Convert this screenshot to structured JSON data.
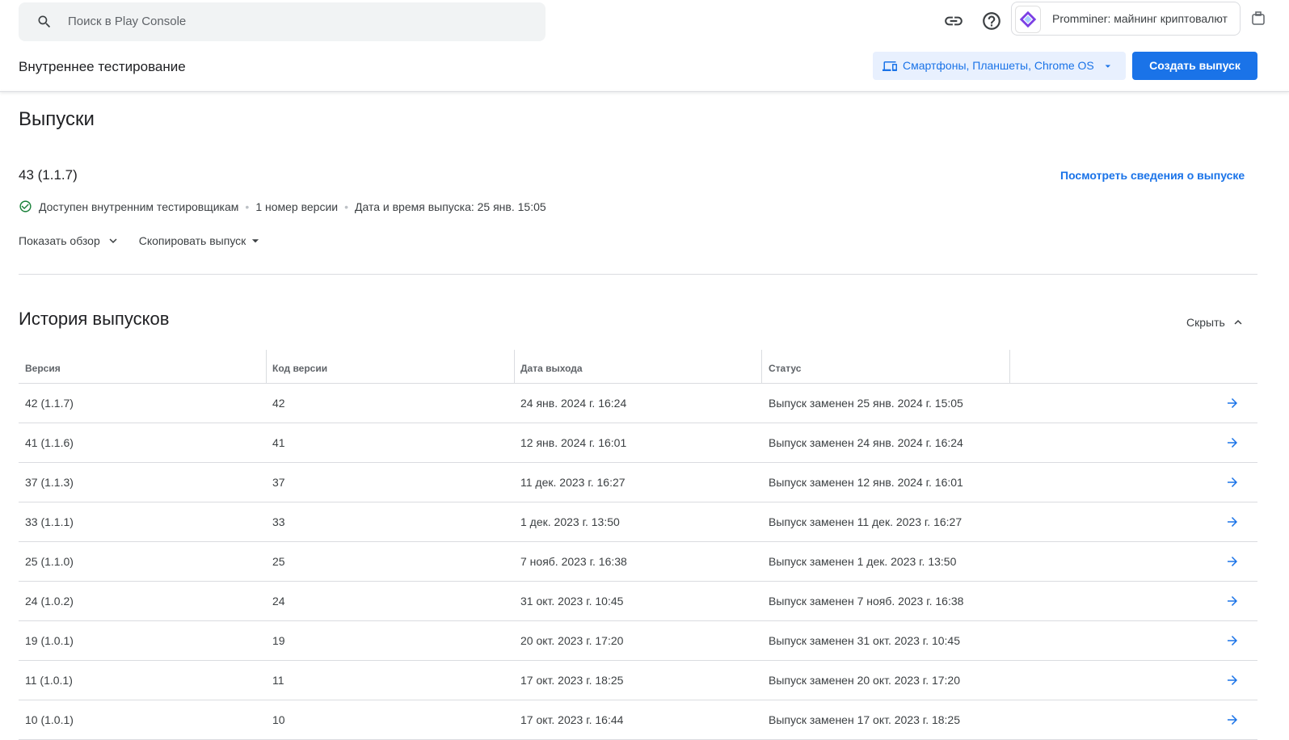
{
  "search": {
    "placeholder": "Поиск в Play Console"
  },
  "app": {
    "name": "Promminer: майнинг криптовалют"
  },
  "header": {
    "title": "Внутреннее тестирование",
    "device_label": "Смартфоны, Планшеты, Chrome OS",
    "create_label": "Создать выпуск"
  },
  "releases": {
    "title": "Выпуски",
    "current": {
      "name": "43 (1.1.7)",
      "view_link": "Посмотреть сведения о выпуске",
      "status": "Доступен внутренним тестировщикам",
      "version_count": "1 номер версии",
      "release_datetime": "Дата и время выпуска: 25 янв. 15:05",
      "show_overview": "Показать обзор",
      "copy_release": "Скопировать выпуск"
    }
  },
  "history": {
    "title": "История выпусков",
    "hide_label": "Скрыть",
    "columns": [
      "Версия",
      "Код версии",
      "Дата выхода",
      "Статус"
    ],
    "rows": [
      {
        "version": "42 (1.1.7)",
        "code": "42",
        "date": "24 янв. 2024 г. 16:24",
        "status": "Выпуск заменен 25 янв. 2024 г. 15:05"
      },
      {
        "version": "41 (1.1.6)",
        "code": "41",
        "date": "12 янв. 2024 г. 16:01",
        "status": "Выпуск заменен 24 янв. 2024 г. 16:24"
      },
      {
        "version": "37 (1.1.3)",
        "code": "37",
        "date": "11 дек. 2023 г. 16:27",
        "status": "Выпуск заменен 12 янв. 2024 г. 16:01"
      },
      {
        "version": "33 (1.1.1)",
        "code": "33",
        "date": "1 дек. 2023 г. 13:50",
        "status": "Выпуск заменен 11 дек. 2023 г. 16:27"
      },
      {
        "version": "25 (1.1.0)",
        "code": "25",
        "date": "7 нояб. 2023 г. 16:38",
        "status": "Выпуск заменен 1 дек. 2023 г. 13:50"
      },
      {
        "version": "24 (1.0.2)",
        "code": "24",
        "date": "31 окт. 2023 г. 10:45",
        "status": "Выпуск заменен 7 нояб. 2023 г. 16:38"
      },
      {
        "version": "19 (1.0.1)",
        "code": "19",
        "date": "20 окт. 2023 г. 17:20",
        "status": "Выпуск заменен 31 окт. 2023 г. 10:45"
      },
      {
        "version": "11 (1.0.1)",
        "code": "11",
        "date": "17 окт. 2023 г. 18:25",
        "status": "Выпуск заменен 20 окт. 2023 г. 17:20"
      },
      {
        "version": "10 (1.0.1)",
        "code": "10",
        "date": "17 окт. 2023 г. 16:44",
        "status": "Выпуск заменен 17 окт. 2023 г. 18:25"
      }
    ]
  },
  "colors": {
    "accent": "#1a73e8",
    "success": "#188038",
    "divider": "#dadce0"
  },
  "icons": [
    "search-icon",
    "link-icon",
    "help-icon",
    "app-logo-icon",
    "device-icon",
    "dropdown-arrow-icon",
    "check-circle-icon",
    "chevron-down-icon",
    "chevron-up-icon",
    "arrow-right-icon"
  ]
}
